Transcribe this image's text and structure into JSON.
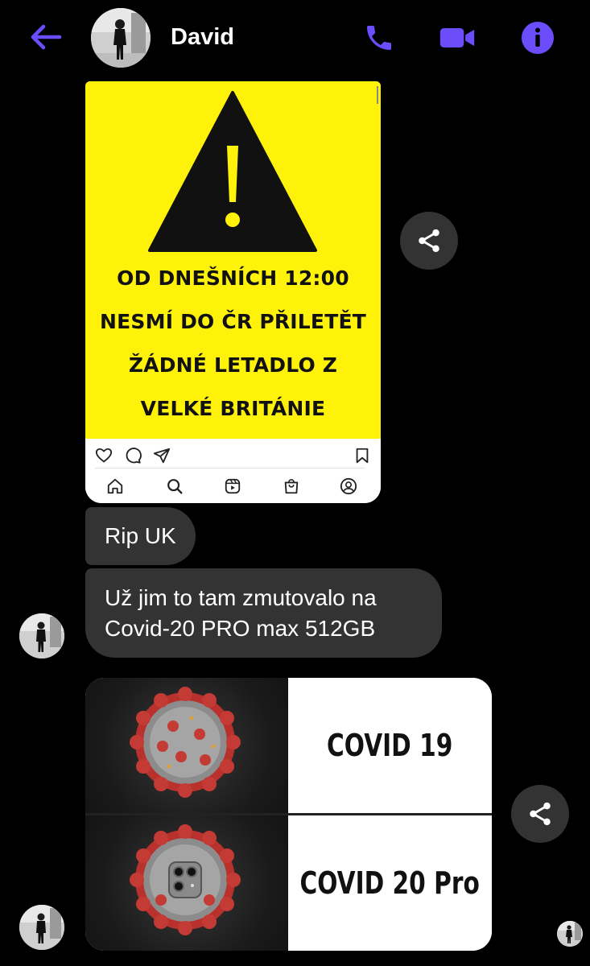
{
  "header": {
    "contact_name": "David",
    "icons": [
      "back-arrow-icon",
      "phone-icon",
      "video-camera-icon",
      "info-icon"
    ],
    "accent_color": "#6b4dfc"
  },
  "messages": {
    "instagram_post": {
      "lines": [
        "OD DNEŠNÍCH 12:00",
        "NESMÍ DO ČR PŘILETĚT",
        "ŽÁDNÉ LETADLO Z",
        "VELKÉ BRITÁNIE"
      ],
      "background_color": "#fff20a"
    },
    "text_1": "Rip UK",
    "text_2_line1": "Už jim to tam zmutovalo na",
    "text_2_line2": "Covid-20 PRO max 512GB",
    "meme": {
      "top_label": "COVID 19",
      "bottom_label": "COVID 20 Pro"
    }
  },
  "colors": {
    "background": "#000000",
    "bubble": "#333333"
  }
}
